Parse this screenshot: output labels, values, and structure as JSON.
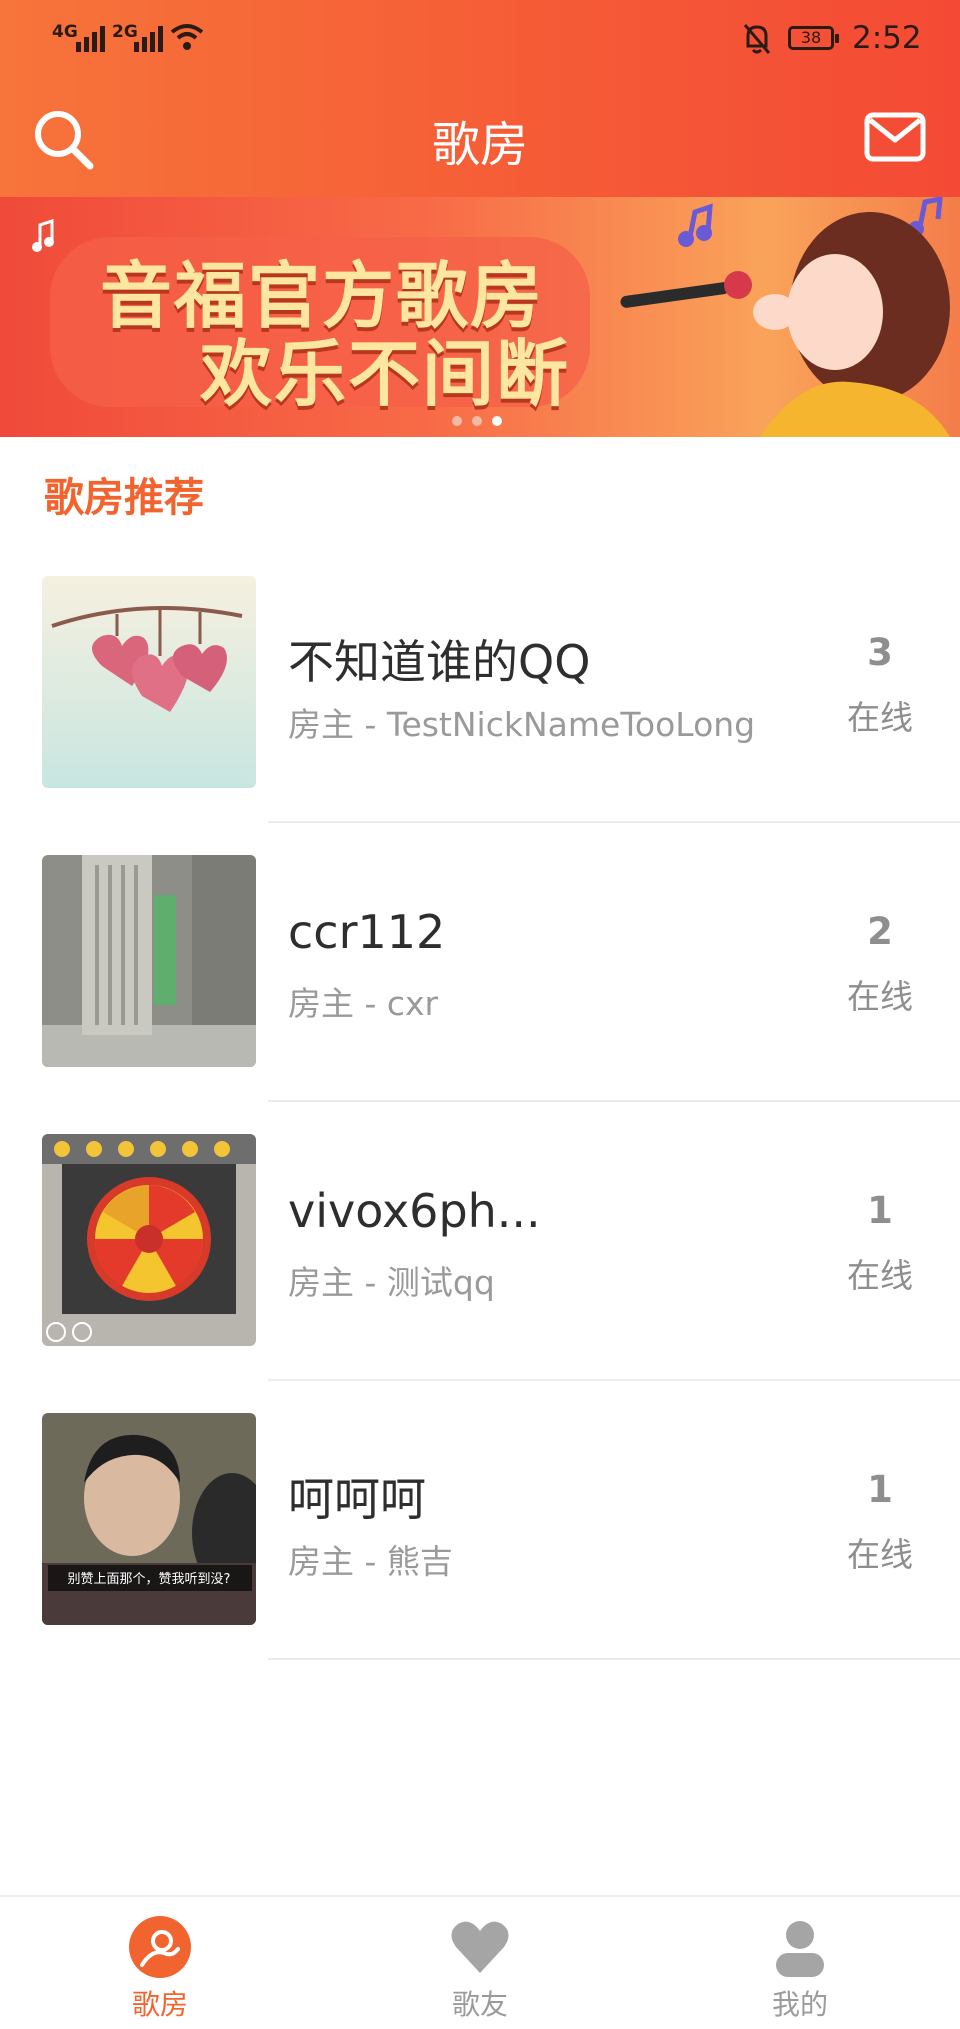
{
  "status_bar": {
    "signal1": "4G",
    "signal2": "2G",
    "battery": "38",
    "time": "2:52"
  },
  "header": {
    "title": "歌房"
  },
  "banner": {
    "line1": "音福官方歌房",
    "line2": "欢乐不间断",
    "active_dot": 2
  },
  "section": {
    "title": "歌房推荐"
  },
  "rooms": [
    {
      "name": "不知道谁的QQ",
      "host": "房主 - TestNickNameTooLong",
      "count": "3",
      "status": "在线"
    },
    {
      "name": "ccr112",
      "host": "房主 - cxr",
      "count": "2",
      "status": "在线"
    },
    {
      "name": "vivox6ph...",
      "host": "房主 - 测试qq",
      "count": "1",
      "status": "在线"
    },
    {
      "name": "呵呵呵",
      "host": "房主 - 熊吉",
      "count": "1",
      "status": "在线"
    }
  ],
  "thumb_captions": {
    "meme": "别赞上面那个，赞我听到没?"
  },
  "tabs": [
    {
      "label": "歌房",
      "icon": "karaoke-icon",
      "active": true
    },
    {
      "label": "歌友",
      "icon": "heart-icon",
      "active": false
    },
    {
      "label": "我的",
      "icon": "person-icon",
      "active": false
    }
  ],
  "colors": {
    "accent": "#f2642f",
    "header_start": "#f7743a",
    "header_end": "#f44a35"
  }
}
